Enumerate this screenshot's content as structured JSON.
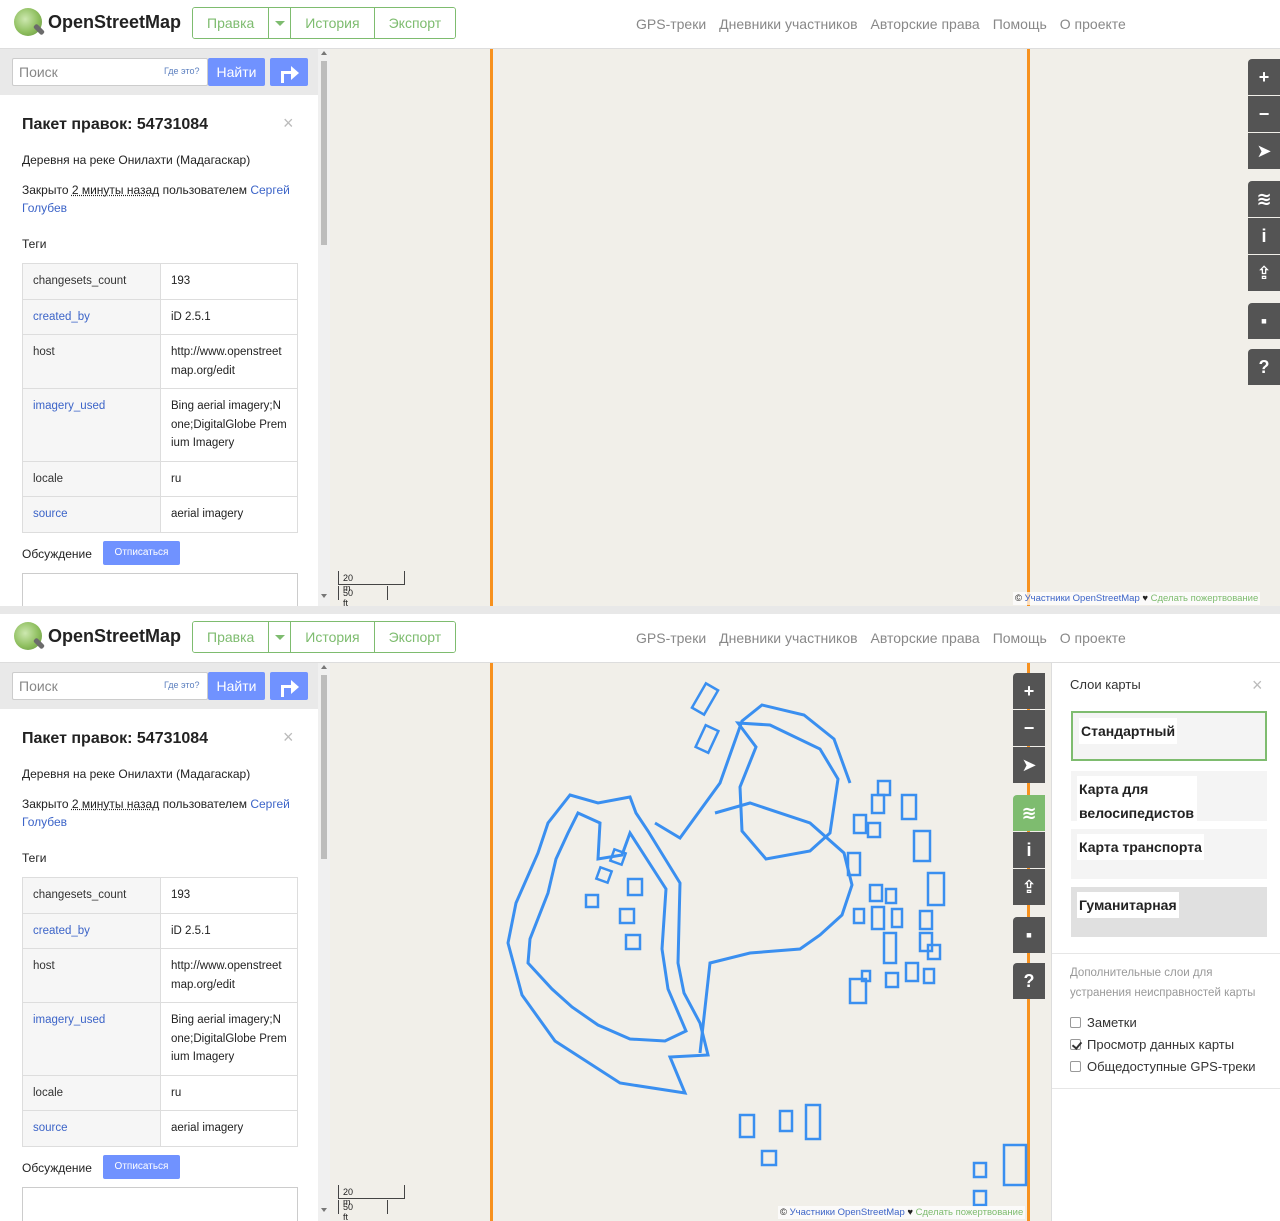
{
  "header": {
    "logo_text": "OpenStreetMap",
    "edit": "Правка",
    "history": "История",
    "export": "Экспорт",
    "nav": [
      "GPS-треки",
      "Дневники участников",
      "Авторские права",
      "Помощь",
      "О проекте"
    ]
  },
  "search": {
    "placeholder": "Поиск",
    "where": "Где это?",
    "find": "Найти"
  },
  "changeset": {
    "title": "Пакет правок: 54731084",
    "description": "Деревня на реке Онилахти (Мадагаскар)",
    "closed_prefix": "Закрыто ",
    "closed_time": "2 минуты назад",
    "closed_mid": " пользователем ",
    "user": "Сергей Голубев",
    "tags_heading": "Теги",
    "tags": [
      {
        "key": "changesets_count",
        "value": "193",
        "key_link": false
      },
      {
        "key": "created_by",
        "value": "iD 2.5.1",
        "key_link": true
      },
      {
        "key": "host",
        "value": "http://www.openstreetmap.org/edit",
        "key_link": false
      },
      {
        "key": "imagery_used",
        "value": "Bing aerial imagery;None;DigitalGlobe Premium Imagery",
        "key_link": true
      },
      {
        "key": "locale",
        "value": "ru",
        "key_link": false
      },
      {
        "key": "source",
        "value": "aerial imagery",
        "key_link": true
      }
    ],
    "discussion": "Обсуждение",
    "unsubscribe": "Отписаться"
  },
  "map": {
    "scale_m": "20 m",
    "scale_ft": "50 ft",
    "attrib_copy": "©",
    "attrib_contrib": "Участники OpenStreetMap",
    "attrib_heart": "♥",
    "attrib_donate": "Сделать пожертвование",
    "boundary_color": "#f7911e",
    "feature_color": "#3a8ff0"
  },
  "controls": {
    "zoom_in": "+",
    "zoom_out": "−",
    "help": "?"
  },
  "layers_panel": {
    "title": "Слои карты",
    "layers": [
      "Стандартный",
      "Карта для велосипедистов",
      "Карта транспорта",
      "Гуманитарная"
    ],
    "selected": "Стандартный",
    "overlay_note": "Дополнительные слои для устранения неисправностей карты",
    "overlays": [
      {
        "label": "Заметки",
        "checked": false
      },
      {
        "label": "Просмотр данных карты",
        "checked": true
      },
      {
        "label": "Общедоступные GPS-треки",
        "checked": false
      }
    ]
  }
}
